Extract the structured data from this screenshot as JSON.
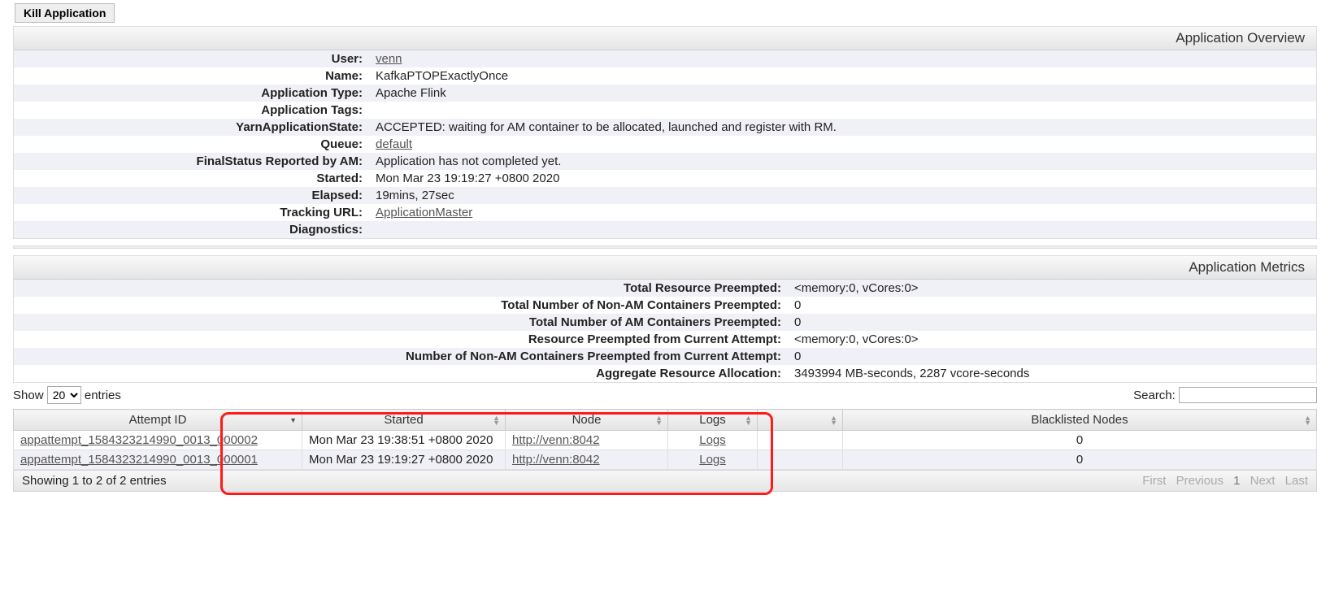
{
  "kill_button_label": "Kill Application",
  "overview": {
    "title": "Application Overview",
    "rows": [
      {
        "label": "User:",
        "value": "venn",
        "link": true
      },
      {
        "label": "Name:",
        "value": "KafkaPTOPExactlyOnce"
      },
      {
        "label": "Application Type:",
        "value": "Apache Flink"
      },
      {
        "label": "Application Tags:",
        "value": ""
      },
      {
        "label": "YarnApplicationState:",
        "value": "ACCEPTED: waiting for AM container to be allocated, launched and register with RM."
      },
      {
        "label": "Queue:",
        "value": "default",
        "link": true
      },
      {
        "label": "FinalStatus Reported by AM:",
        "value": "Application has not completed yet."
      },
      {
        "label": "Started:",
        "value": "Mon Mar 23 19:19:27 +0800 2020"
      },
      {
        "label": "Elapsed:",
        "value": "19mins, 27sec"
      },
      {
        "label": "Tracking URL:",
        "value": "ApplicationMaster",
        "link": true
      },
      {
        "label": "Diagnostics:",
        "value": ""
      }
    ]
  },
  "metrics": {
    "title": "Application Metrics",
    "rows": [
      {
        "label": "Total Resource Preempted:",
        "value": "<memory:0, vCores:0>"
      },
      {
        "label": "Total Number of Non-AM Containers Preempted:",
        "value": "0"
      },
      {
        "label": "Total Number of AM Containers Preempted:",
        "value": "0"
      },
      {
        "label": "Resource Preempted from Current Attempt:",
        "value": "<memory:0, vCores:0>"
      },
      {
        "label": "Number of Non-AM Containers Preempted from Current Attempt:",
        "value": "0"
      },
      {
        "label": "Aggregate Resource Allocation:",
        "value": "3493994 MB-seconds, 2287 vcore-seconds"
      }
    ]
  },
  "datatable": {
    "show_prefix": "Show",
    "show_suffix": "entries",
    "page_size": "20",
    "search_label": "Search:",
    "search_value": "",
    "columns": [
      "Attempt ID",
      "Started",
      "Node",
      "Logs",
      "",
      "Blacklisted Nodes"
    ],
    "rows": [
      {
        "attempt_id": "appattempt_1584323214990_0013_000002",
        "started": "Mon Mar 23 19:38:51 +0800 2020",
        "node": "http://venn:8042",
        "logs": "Logs",
        "extra": "",
        "blacklisted": "0"
      },
      {
        "attempt_id": "appattempt_1584323214990_0013_000001",
        "started": "Mon Mar 23 19:19:27 +0800 2020",
        "node": "http://venn:8042",
        "logs": "Logs",
        "extra": "",
        "blacklisted": "0"
      }
    ],
    "info_text": "Showing 1 to 2 of 2 entries",
    "pager": {
      "first": "First",
      "prev": "Previous",
      "page": "1",
      "next": "Next",
      "last": "Last"
    }
  }
}
